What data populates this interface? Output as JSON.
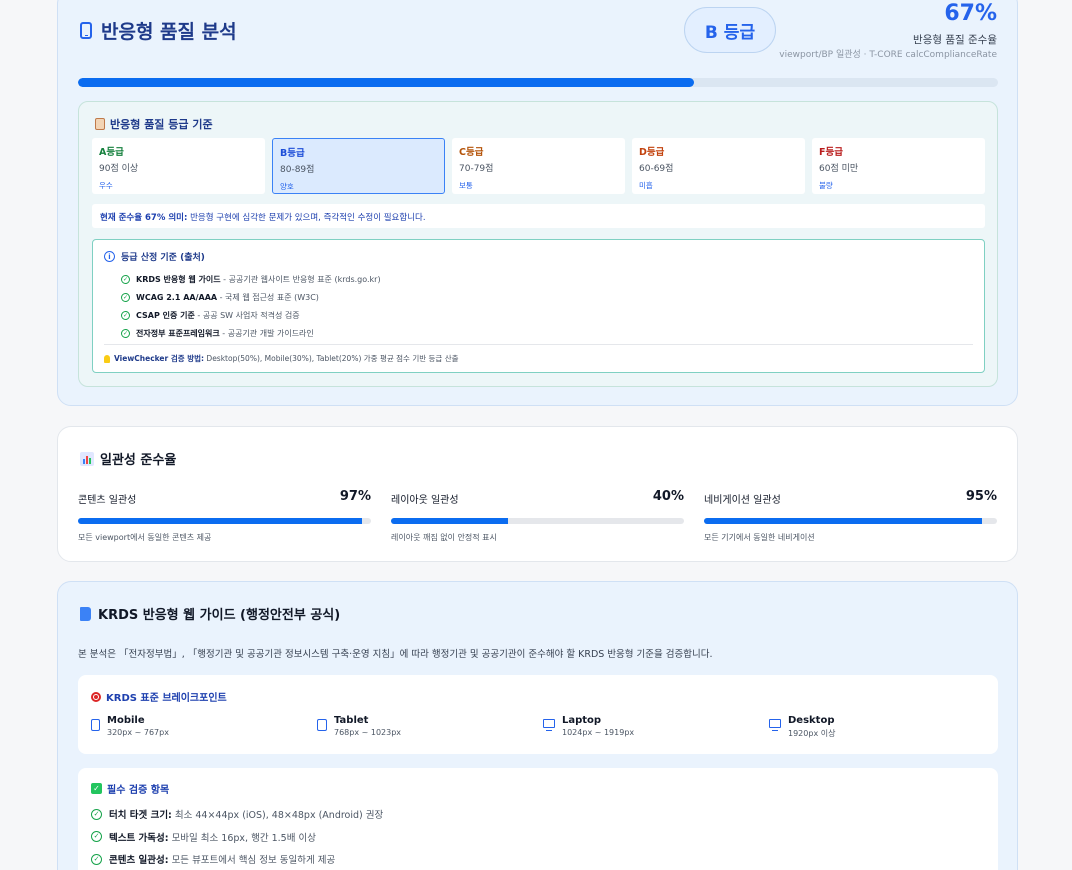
{
  "quality": {
    "title": "반응형 품질 분석",
    "grade_badge": "B 등급",
    "score_pct": "67%",
    "score_value": 0.67,
    "score_label": "반응형 품질 준수율",
    "score_sub": "viewport/BP 일관성 · T-CORE calcComplianceRate",
    "grade_box": {
      "title": "반응형 품질 등급 기준",
      "grades": [
        {
          "name": "A등급",
          "range": "90점 이상",
          "label": "우수",
          "color": "#15803d"
        },
        {
          "name": "B등급",
          "range": "80-89점",
          "label": "양호",
          "color": "#1d4ed8"
        },
        {
          "name": "C등급",
          "range": "70-79점",
          "label": "보통",
          "color": "#b45309"
        },
        {
          "name": "D등급",
          "range": "60-69점",
          "label": "미흡",
          "color": "#c2410c"
        },
        {
          "name": "F등급",
          "range": "60점 미만",
          "label": "불량",
          "color": "#b91c1c"
        }
      ],
      "meaning_bold": "현재 준수율 67% 의미:",
      "meaning_text": " 반응형 구현에 심각한 문제가 있으며, 즉각적인 수정이 필요합니다.",
      "criteria": {
        "title": "등급 산정 기준 (출처)",
        "items": [
          {
            "bold": "KRDS 반응형 웹 가이드",
            "text": " - 공공기관 웹사이트 반응형 표준 (krds.go.kr)"
          },
          {
            "bold": "WCAG 2.1 AA/AAA",
            "text": " - 국제 웹 접근성 표준 (W3C)"
          },
          {
            "bold": "CSAP 인증 기준",
            "text": " - 공공 SW 사업자 적격성 검증"
          },
          {
            "bold": "전자정부 표준프레임워크",
            "text": " - 공공기관 개발 가이드라인"
          }
        ],
        "note_bold": "ViewChecker 검증 방법:",
        "note_text": " Desktop(50%), Mobile(30%), Tablet(20%) 가중 평균 점수 기반 등급 산출"
      }
    }
  },
  "consistency": {
    "title": "일관성 준수율",
    "metrics": [
      {
        "label": "콘텐츠 일관성",
        "pct": "97%",
        "value": 0.97,
        "desc": "모든 viewport에서 동일한 콘텐츠 제공"
      },
      {
        "label": "레이아웃 일관성",
        "pct": "40%",
        "value": 0.4,
        "desc": "레이아웃 깨짐 없이 안정적 표시"
      },
      {
        "label": "네비게이션 일관성",
        "pct": "95%",
        "value": 0.95,
        "desc": "모든 기기에서 동일한 네비게이션"
      }
    ]
  },
  "krds": {
    "title": "KRDS 반응형 웹 가이드 (행정안전부 공식)",
    "description": "본 분석은 「전자정부법」, 「행정기관 및 공공기관 정보시스템 구축·운영 지침」에 따라 행정기관 및 공공기관이 준수해야 할 KRDS 반응형 기준을 검증합니다.",
    "breakpoints": {
      "title": "KRDS 표준 브레이크포인트",
      "items": [
        {
          "name": "Mobile",
          "range": "320px ~ 767px",
          "icon": "mobile-icon"
        },
        {
          "name": "Tablet",
          "range": "768px ~ 1023px",
          "icon": "tablet-icon"
        },
        {
          "name": "Laptop",
          "range": "1024px ~ 1919px",
          "icon": "laptop-icon"
        },
        {
          "name": "Desktop",
          "range": "1920px 이상",
          "icon": "desktop-icon"
        }
      ]
    },
    "required": {
      "title": "필수 검증 항목",
      "items": [
        {
          "bold": "터치 타겟 크기:",
          "text": " 최소 44×44px (iOS), 48×48px (Android) 권장"
        },
        {
          "bold": "텍스트 가독성:",
          "text": " 모바일 최소 16px, 행간 1.5배 이상"
        },
        {
          "bold": "콘텐츠 일관성:",
          "text": " 모든 뷰포트에서 핵심 정보 동일하게 제공"
        }
      ]
    }
  }
}
